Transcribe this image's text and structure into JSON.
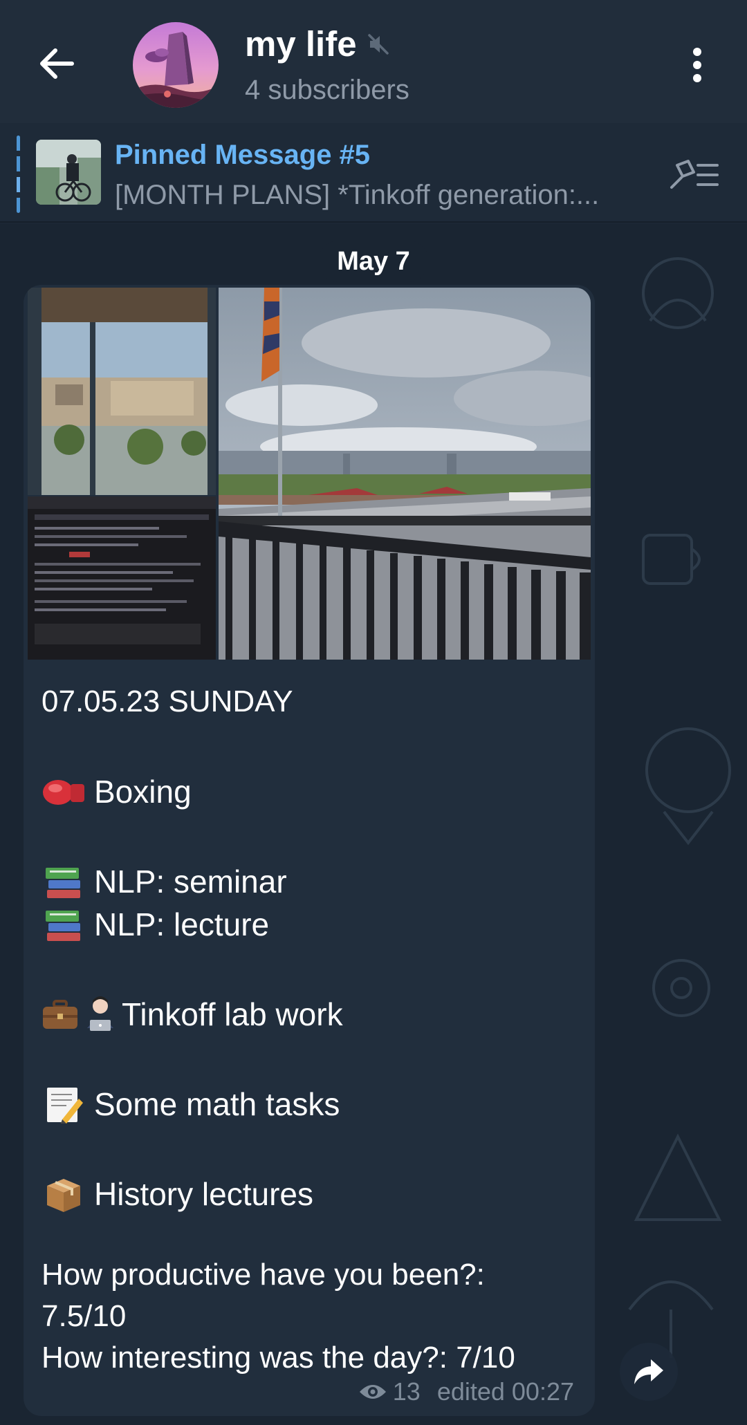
{
  "header": {
    "title": "my life",
    "subtitle": "4 subscribers",
    "icons": {
      "back": "arrow-left-icon",
      "muted": "muted-speaker-icon",
      "menu": "more-vertical-icon"
    }
  },
  "pinned": {
    "title": "Pinned Message #5",
    "text": "[MONTH PLANS]  *Tinkoff generation:...",
    "icons": {
      "list": "pin-list-icon"
    }
  },
  "chat": {
    "date": "May 7",
    "message": {
      "heading": "07.05.23 SUNDAY",
      "items": [
        {
          "emoji": "boxing-glove",
          "text": "Boxing"
        },
        {
          "emoji": "books",
          "text": "NLP: seminar"
        },
        {
          "emoji": "books",
          "text": "NLP: lecture"
        },
        {
          "emoji": "briefcase-technologist",
          "text": "Tinkoff lab work"
        },
        {
          "emoji": "memo",
          "text": "Some math tasks"
        },
        {
          "emoji": "package",
          "text": "History lectures"
        }
      ],
      "question1": "How productive have you been?:",
      "answer1": "7.5/10",
      "question2": "How interesting was the day?: 7/10",
      "views": "13",
      "edited": "edited 00:27"
    }
  },
  "icons": {
    "views": "eye-icon",
    "share": "share-arrow-icon"
  }
}
